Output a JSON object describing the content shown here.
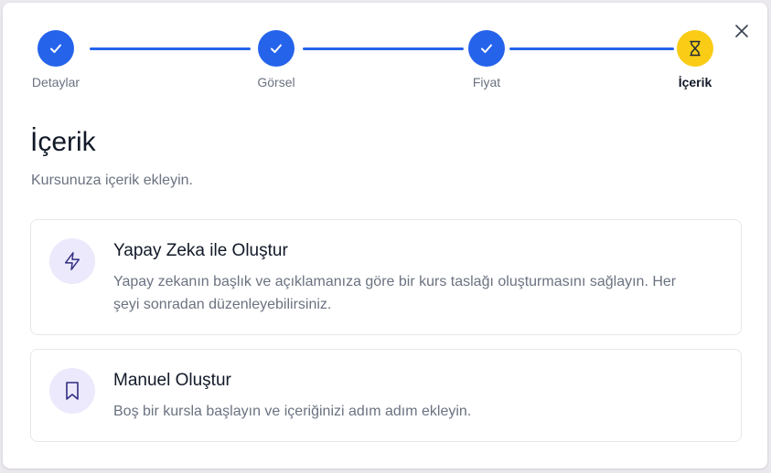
{
  "dialog": {
    "close_icon": "close-icon"
  },
  "stepper": {
    "steps": [
      {
        "label": "Detaylar",
        "status": "completed",
        "icon": "check-icon"
      },
      {
        "label": "Görsel",
        "status": "completed",
        "icon": "check-icon"
      },
      {
        "label": "Fiyat",
        "status": "completed",
        "icon": "check-icon"
      },
      {
        "label": "İçerik",
        "status": "current",
        "icon": "hourglass-icon"
      }
    ]
  },
  "header": {
    "title": "İçerik",
    "subtitle": "Kursunuza içerik ekleyin."
  },
  "options": [
    {
      "icon": "lightning-icon",
      "title": "Yapay Zeka ile Oluştur",
      "description": "Yapay zekanın başlık ve açıklamanıza göre bir kurs taslağı oluşturmasını sağlayın. Her şeyi sonradan düzenleyebilirsiniz."
    },
    {
      "icon": "bookmark-icon",
      "title": "Manuel Oluştur",
      "description": "Boş bir kursla başlayın ve içeriğinizi adım adım ekleyin."
    }
  ],
  "colors": {
    "accent": "#2563eb",
    "current_step": "#facc15",
    "icon_bg": "#ebe9fb",
    "icon_stroke": "#312e81"
  }
}
